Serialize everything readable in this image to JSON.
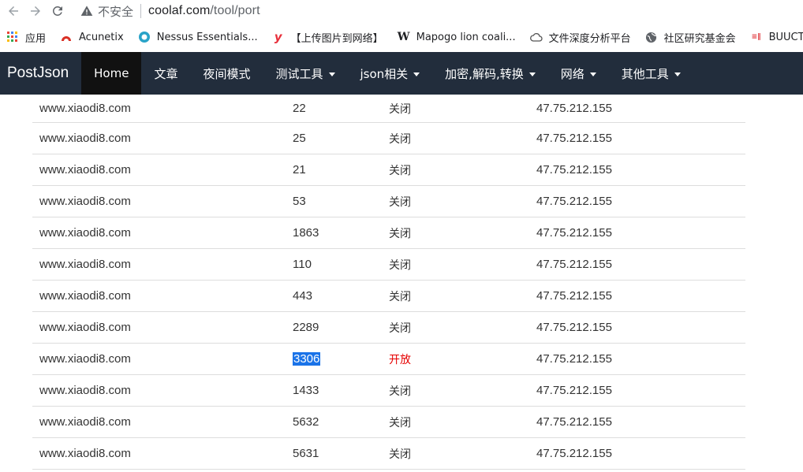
{
  "browser": {
    "insecure_label": "不安全",
    "url_host": "coolaf.com",
    "url_path": "/tool/port"
  },
  "bookmarks": [
    {
      "label": "应用",
      "icon": "apps-grid-icon"
    },
    {
      "label": "Acunetix",
      "icon": "acunetix-icon"
    },
    {
      "label": "Nessus Essentials...",
      "icon": "nessus-icon"
    },
    {
      "label": "【上传图片到网络】",
      "icon": "y-logo-icon"
    },
    {
      "label": "Mapogo lion coali...",
      "icon": "wikipedia-w-icon"
    },
    {
      "label": "文件深度分析平台",
      "icon": "cloud-icon"
    },
    {
      "label": "社区研究基金会",
      "icon": "globe-icon"
    },
    {
      "label": "BUUCTF",
      "icon": "buuctf-icon"
    }
  ],
  "navbar": {
    "brand": "PostJson",
    "items": [
      {
        "label": "Home",
        "active": true,
        "dropdown": false
      },
      {
        "label": "文章",
        "active": false,
        "dropdown": false
      },
      {
        "label": "夜间模式",
        "active": false,
        "dropdown": false
      },
      {
        "label": "测试工具",
        "active": false,
        "dropdown": true
      },
      {
        "label": "json相关",
        "active": false,
        "dropdown": true
      },
      {
        "label": "加密,解码,转换",
        "active": false,
        "dropdown": true
      },
      {
        "label": "网络",
        "active": false,
        "dropdown": true
      },
      {
        "label": "其他工具",
        "active": false,
        "dropdown": true
      }
    ]
  },
  "colors": {
    "navbar_bg": "#222d3c",
    "active_nav_bg": "#111111",
    "open_status": "#e60000",
    "selection": "#1a73e8"
  },
  "table": {
    "rows": [
      {
        "host": "www.xiaodi8.com",
        "port": "22",
        "status": "关闭",
        "ip": "47.75.212.155",
        "open": false,
        "selected": false
      },
      {
        "host": "www.xiaodi8.com",
        "port": "25",
        "status": "关闭",
        "ip": "47.75.212.155",
        "open": false,
        "selected": false
      },
      {
        "host": "www.xiaodi8.com",
        "port": "21",
        "status": "关闭",
        "ip": "47.75.212.155",
        "open": false,
        "selected": false
      },
      {
        "host": "www.xiaodi8.com",
        "port": "53",
        "status": "关闭",
        "ip": "47.75.212.155",
        "open": false,
        "selected": false
      },
      {
        "host": "www.xiaodi8.com",
        "port": "1863",
        "status": "关闭",
        "ip": "47.75.212.155",
        "open": false,
        "selected": false
      },
      {
        "host": "www.xiaodi8.com",
        "port": "110",
        "status": "关闭",
        "ip": "47.75.212.155",
        "open": false,
        "selected": false
      },
      {
        "host": "www.xiaodi8.com",
        "port": "443",
        "status": "关闭",
        "ip": "47.75.212.155",
        "open": false,
        "selected": false
      },
      {
        "host": "www.xiaodi8.com",
        "port": "2289",
        "status": "关闭",
        "ip": "47.75.212.155",
        "open": false,
        "selected": false
      },
      {
        "host": "www.xiaodi8.com",
        "port": "3306",
        "status": "开放",
        "ip": "47.75.212.155",
        "open": true,
        "selected": true
      },
      {
        "host": "www.xiaodi8.com",
        "port": "1433",
        "status": "关闭",
        "ip": "47.75.212.155",
        "open": false,
        "selected": false
      },
      {
        "host": "www.xiaodi8.com",
        "port": "5632",
        "status": "关闭",
        "ip": "47.75.212.155",
        "open": false,
        "selected": false
      },
      {
        "host": "www.xiaodi8.com",
        "port": "5631",
        "status": "关闭",
        "ip": "47.75.212.155",
        "open": false,
        "selected": false
      }
    ]
  }
}
